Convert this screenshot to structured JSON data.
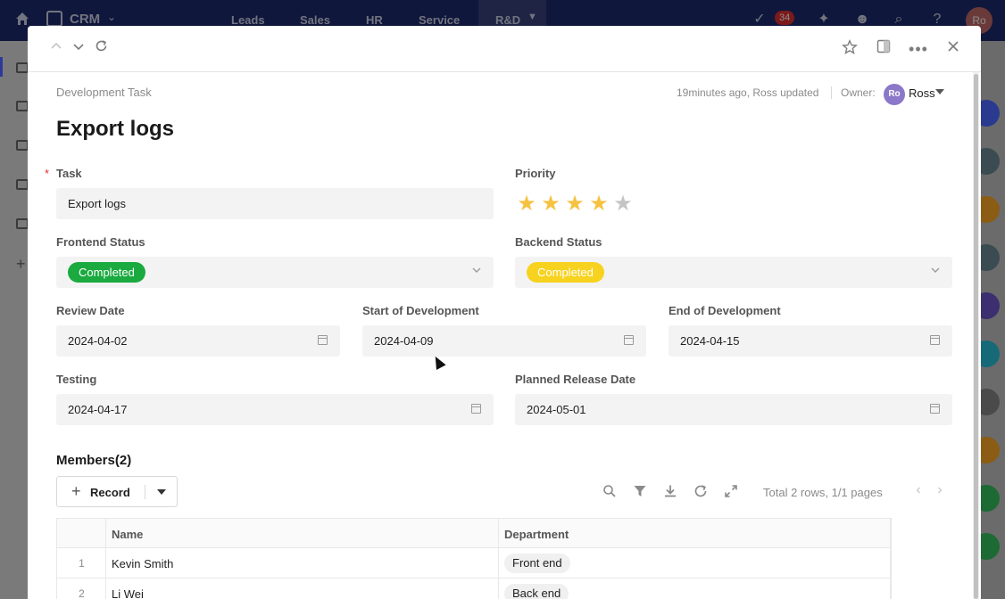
{
  "app": {
    "name": "CRM",
    "nav": [
      "Leads",
      "Sales",
      "HR",
      "Service",
      "R&D"
    ],
    "notification_count": "34",
    "user_initials": "Ro"
  },
  "modal": {
    "breadcrumb": "Development Task",
    "updated": "19minutes ago, Ross updated",
    "owner_label": "Owner:",
    "owner_initials": "Ro",
    "owner_name": "Ross",
    "title": "Export logs",
    "fields": {
      "task": {
        "label": "Task",
        "value": "Export logs",
        "required": "*"
      },
      "priority": {
        "label": "Priority",
        "rating": 4,
        "max": 5
      },
      "frontend_status": {
        "label": "Frontend Status",
        "value": "Completed",
        "color": "#1aaa3f"
      },
      "backend_status": {
        "label": "Backend Status",
        "value": "Completed",
        "color": "#f7d21f"
      },
      "review_date": {
        "label": "Review Date",
        "value": "2024-04-02"
      },
      "start_dev": {
        "label": "Start of Development",
        "value": "2024-04-09"
      },
      "end_dev": {
        "label": "End of Development",
        "value": "2024-04-15"
      },
      "testing": {
        "label": "Testing",
        "value": "2024-04-17"
      },
      "planned_release": {
        "label": "Planned Release Date",
        "value": "2024-05-01"
      }
    },
    "members": {
      "title": "Members(2)",
      "record_label": "Record",
      "totals": "Total 2 rows, 1/1 pages",
      "columns": [
        "Name",
        "Department"
      ],
      "rows": [
        {
          "num": "1",
          "name": "Kevin Smith",
          "department": "Front end"
        },
        {
          "num": "2",
          "name": "Li Wei",
          "department": "Back end"
        }
      ]
    }
  }
}
